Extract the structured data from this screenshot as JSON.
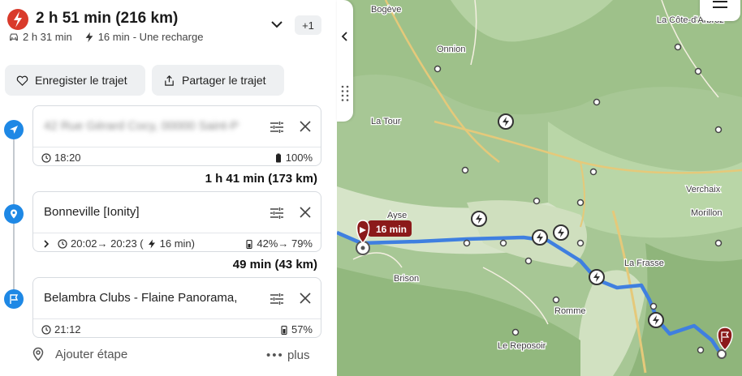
{
  "header": {
    "title": "2 h 51 min (216 km)",
    "drive_time": "2 h 31 min",
    "charge_time": "16 min",
    "charge_label": "- Une recharge",
    "extra_badge": "+1"
  },
  "actions": {
    "save_label": "Enregister le trajet",
    "share_label": "Partager le trajet"
  },
  "stops": [
    {
      "address": "42 Rue Gérard Cocy, 00000 Saint-P",
      "time": "18:20",
      "battery": "100%"
    },
    {
      "address": "Bonneville [Ionity]",
      "time_range": "20:02→ 20:23 (",
      "charge_duration": "16 min)",
      "battery_range": "42%→ 79%"
    },
    {
      "address": "Belambra Clubs - Flaine Panorama,",
      "time": "21:12",
      "battery": "57%"
    }
  ],
  "segments": [
    {
      "duration": "1 h 41 min (173 km)"
    },
    {
      "duration": "49 min (43 km)"
    }
  ],
  "add_stop": {
    "label": "Ajouter étape",
    "more_label": "plus"
  },
  "map": {
    "charge_badge": "16 min",
    "places": [
      "Bogève",
      "Onnion",
      "La Tour",
      "Ayse",
      "Brison",
      "Romme",
      "Le Reposoir",
      "La Frasse",
      "Verchaix",
      "Morillon",
      "La Côte-d'Arbroz"
    ],
    "route_color": "#3f7fe0",
    "accent_color": "#1e88e5",
    "marker_color": "#8b1a1a"
  }
}
